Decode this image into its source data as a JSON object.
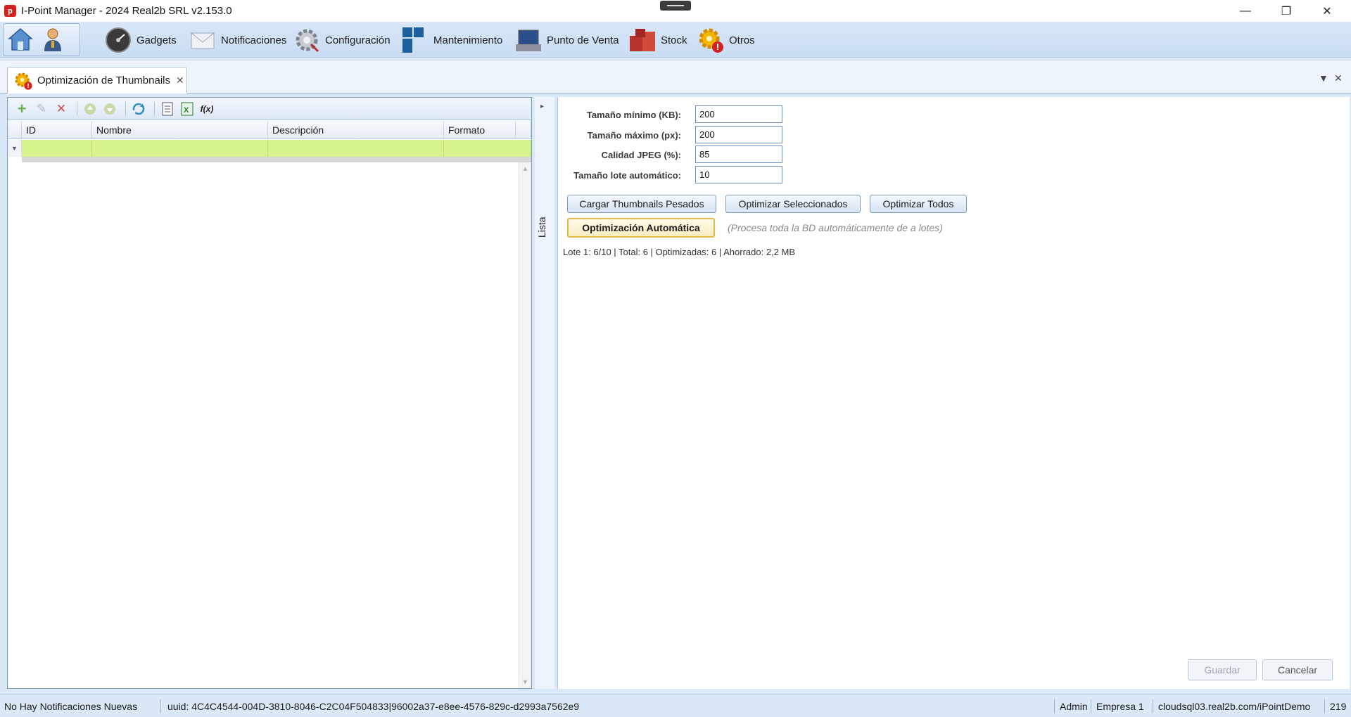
{
  "window": {
    "title": "I-Point Manager - 2024 Real2b SRL v2.153.0",
    "logo_glyph": "p",
    "controls": {
      "minimize": "—",
      "restore": "❐",
      "close": "✕"
    }
  },
  "menu": {
    "items": [
      {
        "label": "Gadgets",
        "icon": "gauge-icon"
      },
      {
        "label": "Notificaciones",
        "icon": "envelope-icon"
      },
      {
        "label": "Configuración",
        "icon": "gear-icon"
      },
      {
        "label": "Mantenimiento",
        "icon": "tiles-icon"
      },
      {
        "label": "Punto de Venta",
        "icon": "monitor-icon"
      },
      {
        "label": "Stock",
        "icon": "boxes-icon"
      },
      {
        "label": "Otros",
        "icon": "gear-alert-icon"
      }
    ]
  },
  "doc_tab": {
    "label": "Optimización de Thumbnails",
    "close": "✕"
  },
  "tabstrip_controls": {
    "dropdown": "▼",
    "close": "✕"
  },
  "grid": {
    "columns": [
      "ID",
      "Nombre",
      "Descripción",
      "Formato"
    ],
    "rows": [],
    "toolbar_icons": [
      "add-icon",
      "edit-icon",
      "delete-icon",
      "move-up-icon",
      "move-down-icon",
      "refresh-icon",
      "export-document-icon",
      "export-excel-icon",
      "formula-icon"
    ],
    "formula_label": "f(x)"
  },
  "splitter": {
    "label": "Lista",
    "chevron": "▸"
  },
  "form": {
    "fields": [
      {
        "label": "Tamaño mínimo (KB):",
        "value": "200"
      },
      {
        "label": "Tamaño máximo (px):",
        "value": "200"
      },
      {
        "label": "Calidad JPEG (%):",
        "value": "85"
      },
      {
        "label": "Tamaño lote automático:",
        "value": "10"
      }
    ],
    "buttons": {
      "load": "Cargar Thumbnails Pesados",
      "optimize_selected": "Optimizar Seleccionados",
      "optimize_all": "Optimizar Todos",
      "auto": "Optimización Automática"
    },
    "hint": "(Procesa toda la BD automáticamente de a lotes)",
    "status": "Lote 1: 6/10 | Total: 6 | Optimizadas: 6 | Ahorrado: 2,2 MB",
    "save": "Guardar",
    "cancel": "Cancelar"
  },
  "statusbar": {
    "notifications": "No Hay Notificaciones Nuevas",
    "uuid": "uuid: 4C4C4544-004D-3810-8046-C2C04F504833|96002a37-e8ee-4576-829c-d2993a7562e9",
    "user": "Admin",
    "company": "Empresa 1",
    "server": "cloudsql03.real2b.com/iPointDemo",
    "extra": "219"
  },
  "colors": {
    "accent": "#2f6fb3",
    "filter_row": "#d7f48c",
    "primary_button_border": "#e0b94a"
  }
}
